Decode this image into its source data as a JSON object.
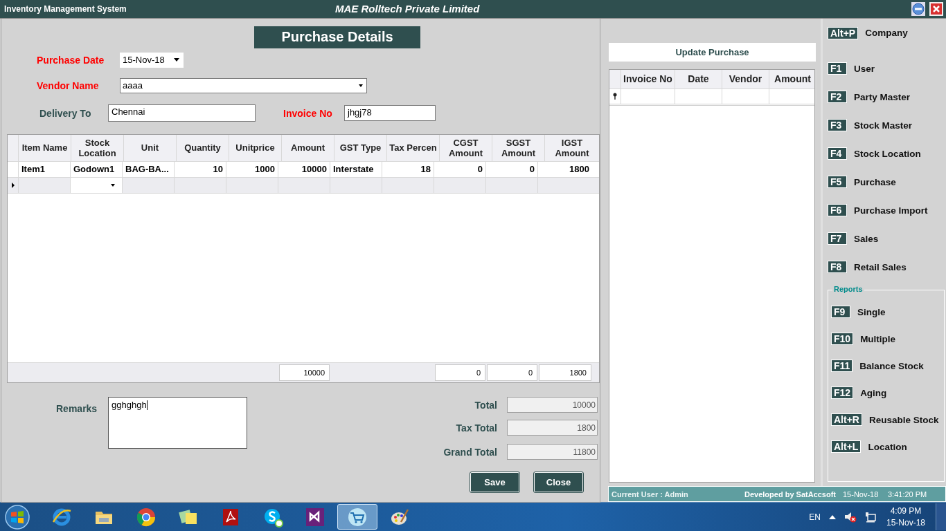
{
  "window": {
    "app_name": "Inventory Management System",
    "company": "MAE Rolltech Private Limited"
  },
  "form": {
    "title": "Purchase Details",
    "purchase_date": {
      "label": "Purchase Date",
      "value": "15-Nov-18",
      "required": true
    },
    "vendor_name": {
      "label": "Vendor Name",
      "value": "aaaa",
      "required": true
    },
    "delivery_to": {
      "label": "Delivery To",
      "value": "Chennai",
      "required": false
    },
    "invoice_no": {
      "label": "Invoice No",
      "value": "jhgj78",
      "required": true
    },
    "items_table": {
      "columns": [
        {
          "label": "Item Name",
          "numeric": false,
          "kind": "text"
        },
        {
          "label": "Stock Location",
          "numeric": false,
          "kind": "combo"
        },
        {
          "label": "Unit",
          "numeric": false,
          "kind": "text"
        },
        {
          "label": "Quantity",
          "numeric": true,
          "kind": "text"
        },
        {
          "label": "Unitprice",
          "numeric": true,
          "kind": "text"
        },
        {
          "label": "Amount",
          "numeric": true,
          "kind": "text",
          "total": "10000"
        },
        {
          "label": "GST Type",
          "numeric": false,
          "kind": "text"
        },
        {
          "label": "Tax Percen",
          "numeric": true,
          "kind": "text"
        },
        {
          "label": "CGST Amount",
          "numeric": true,
          "kind": "text",
          "total": "0"
        },
        {
          "label": "SGST Amount",
          "numeric": true,
          "kind": "text",
          "total": "0"
        },
        {
          "label": "IGST Amount",
          "numeric": true,
          "kind": "text",
          "total": "1800"
        }
      ],
      "rows": [
        {
          "cells": [
            "Item1",
            "Godown1",
            "BAG-BA...",
            "10",
            "1000",
            "10000",
            "Interstate",
            "18",
            "0",
            "0",
            "1800"
          ]
        }
      ],
      "new_row": {
        "current": true
      }
    },
    "remarks": {
      "label": "Remarks",
      "value": "gghghgh"
    },
    "totals": [
      {
        "label": "Total",
        "value": "10000"
      },
      {
        "label": "Tax Total",
        "value": "1800"
      },
      {
        "label": "Grand Total",
        "value": "11800"
      }
    ],
    "buttons": [
      "Save",
      "Close"
    ]
  },
  "update_purchase": {
    "title": "Update Purchase",
    "columns": [
      "Invoice No",
      "Date",
      "Vendor",
      "Amount"
    ]
  },
  "menu": {
    "items": [
      {
        "key": "Alt+P",
        "label": "Company"
      },
      {
        "key": "F1",
        "label": "User"
      },
      {
        "key": "F2",
        "label": "Party Master"
      },
      {
        "key": "F3",
        "label": "Stock Master"
      },
      {
        "key": "F4",
        "label": "Stock Location"
      },
      {
        "key": "F5",
        "label": "Purchase"
      },
      {
        "key": "F6",
        "label": "Purchase Import"
      },
      {
        "key": "F7",
        "label": "Sales"
      },
      {
        "key": "F8",
        "label": "Retail Sales"
      }
    ],
    "reports": {
      "title": "Reports",
      "items": [
        {
          "key": "F9",
          "label": "Single"
        },
        {
          "key": "F10",
          "label": "Multiple"
        },
        {
          "key": "F11",
          "label": "Balance Stock"
        },
        {
          "key": "F12",
          "label": "Aging"
        },
        {
          "key": "Alt+R",
          "label": "Reusable Stock"
        },
        {
          "key": "Alt+L",
          "label": "Location"
        }
      ]
    }
  },
  "status_bar": {
    "user": "Current User : Admin",
    "developer": "Developed by SatAccsoft",
    "date": "15-Nov-18",
    "time": "3:41:20 PM"
  },
  "taskbar": {
    "apps": [
      {
        "kind": "ie",
        "selected": false
      },
      {
        "kind": "folder",
        "selected": false
      },
      {
        "kind": "chrome",
        "selected": false
      },
      {
        "kind": "notes",
        "selected": false
      },
      {
        "kind": "pdf",
        "selected": false
      },
      {
        "kind": "skype",
        "selected": false
      },
      {
        "kind": "vs",
        "selected": false
      },
      {
        "kind": "cart",
        "selected": true
      },
      {
        "kind": "paint",
        "selected": false
      }
    ],
    "language": "EN",
    "clock_time": "4:09 PM",
    "clock_date": "15-Nov-18"
  }
}
